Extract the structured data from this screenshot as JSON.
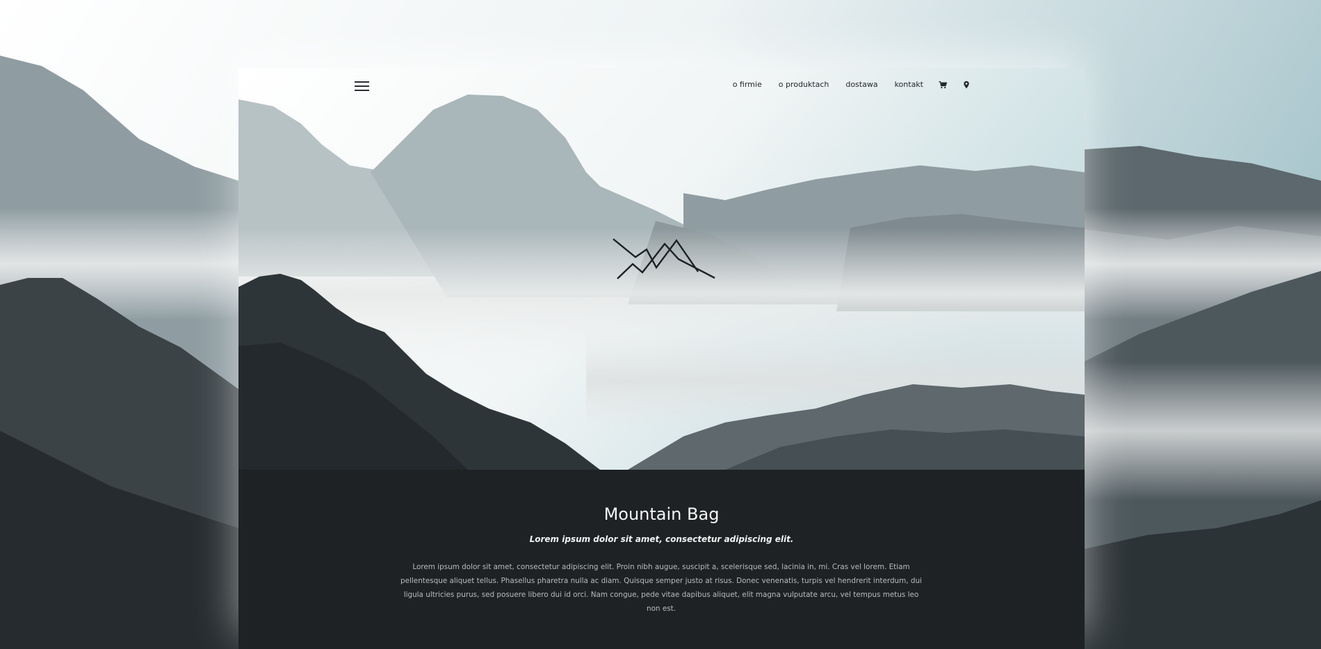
{
  "nav": {
    "items": [
      "o firmie",
      "o produktach",
      "dostawa",
      "kontakt"
    ],
    "cart_icon": "cart-icon",
    "location_icon": "location-pin-icon"
  },
  "menu_icon": "hamburger-menu-icon",
  "logo_icon": "mountain-logo-icon",
  "content": {
    "title": "Mountain Bag",
    "subtitle": "Lorem ipsum dolor sit amet, consectetur adipiscing elit.",
    "body": "Lorem ipsum dolor sit amet, consectetur adipiscing elit. Proin nibh augue, suscipit a, scelerisque sed, lacinia in, mi. Cras vel lorem. Etiam pellentesque aliquet tellus. Phasellus pharetra nulla ac diam. Quisque semper justo at risus. Donec venenatis, turpis vel hendrerit interdum, dui ligula ultricies purus, sed posuere libero dui id orci. Nam congue, pede vitae dapibus aliquet, elit magna vulputate arcu, vel tempus metus leo non est."
  },
  "colors": {
    "dark_section": "#1e2225",
    "sky": "#d6e6ea",
    "fog": "#e4e6e6",
    "forest": "#2a3033"
  }
}
